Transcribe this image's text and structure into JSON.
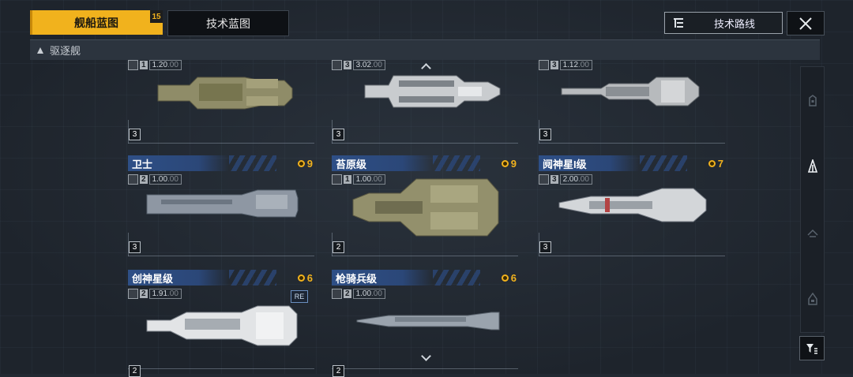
{
  "header": {
    "tab_ship_blueprint": "舰船蓝图",
    "tab_ship_blueprint_badge": "15",
    "tab_tech_blueprint": "技术蓝图",
    "tech_route_label": "技术路线"
  },
  "category": {
    "label": "驱逐舰"
  },
  "colors": {
    "accent": "#f1b21d",
    "name_bar": "#2e4f86",
    "background": "#222932"
  },
  "cards_top_row": [
    {
      "stat_tier": "1",
      "stat_value": "1.20",
      "stat_value_suffix": ".00",
      "level": "3"
    },
    {
      "stat_tier": "3",
      "stat_value": "3.02",
      "stat_value_suffix": ".00",
      "level": "3"
    },
    {
      "stat_tier": "3",
      "stat_value": "1.12",
      "stat_value_suffix": ".00",
      "level": "3"
    }
  ],
  "cards": [
    {
      "name": "卫士",
      "cost": "9",
      "stat_tier": "2",
      "stat_value": "1.00",
      "stat_value_suffix": ".00",
      "level": "3"
    },
    {
      "name": "苔原级",
      "cost": "9",
      "stat_tier": "1",
      "stat_value": "1.00",
      "stat_value_suffix": ".00",
      "level": "2"
    },
    {
      "name": "阋神星I级",
      "cost": "7",
      "stat_tier": "3",
      "stat_value": "2.00",
      "stat_value_suffix": ".00",
      "level": "3"
    },
    {
      "name": "创神星级",
      "cost": "6",
      "stat_tier": "2",
      "stat_value": "1.91",
      "stat_value_suffix": ".00",
      "level": "2",
      "badge": "RE"
    },
    {
      "name": "枪骑兵级",
      "cost": "6",
      "stat_tier": "2",
      "stat_value": "1.00",
      "stat_value_suffix": ".00",
      "level": "2"
    }
  ]
}
